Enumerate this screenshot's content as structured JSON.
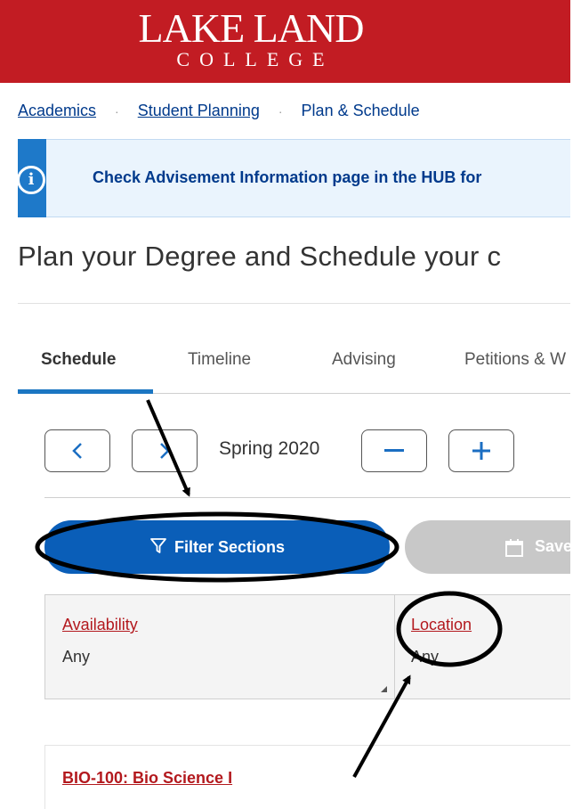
{
  "header": {
    "logo_top": "LAKE LAND",
    "logo_bottom": "COLLEGE",
    "brand_color": "#c21c23"
  },
  "breadcrumb": {
    "items": [
      "Academics",
      "Student Planning",
      "Plan & Schedule"
    ],
    "separator": "·"
  },
  "banner": {
    "icon": "info-icon",
    "text": "Check Advisement Information page in the HUB for "
  },
  "page": {
    "title": "Plan your Degree and Schedule your c"
  },
  "tabs": [
    {
      "label": "Schedule",
      "active": true
    },
    {
      "label": "Timeline",
      "active": false
    },
    {
      "label": "Advising",
      "active": false
    },
    {
      "label": "Petitions & W",
      "active": false
    }
  ],
  "term_nav": {
    "prev_icon": "chevron-left-icon",
    "next_icon": "chevron-right-icon",
    "term": "Spring 2020",
    "remove_icon": "minus-icon",
    "add_icon": "plus-icon"
  },
  "actions": {
    "filter_label": "Filter Sections",
    "filter_icon": "filter-icon",
    "save_label": "Save",
    "save_icon": "calendar-icon",
    "primary_color": "#0a5eb8"
  },
  "filters": [
    {
      "label": "Availability",
      "value": "Any"
    },
    {
      "label": "Location",
      "value": "Any"
    }
  ],
  "courses": [
    {
      "title": "BIO-100: Bio Science I"
    }
  ]
}
